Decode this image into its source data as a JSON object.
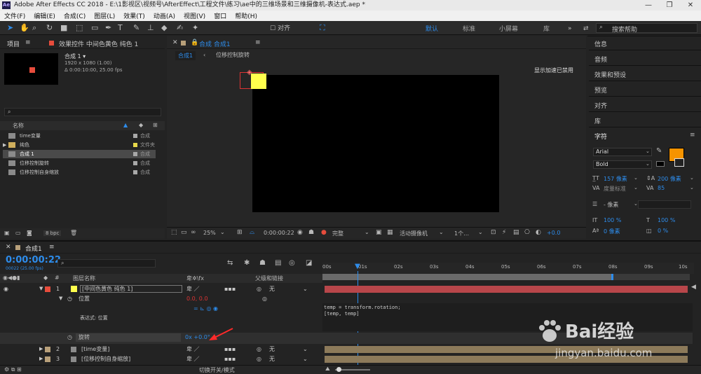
{
  "window": {
    "app_icon": "Ae",
    "title": "Adobe After Effects CC 2018 - E:\\1影视区\\视频号\\AfterEffect\\工程文件\\练习\\ae中的三维场景和三维摄像机-表达式.aep *",
    "controls": [
      "—",
      "❐",
      "✕"
    ]
  },
  "menu": [
    "文件(F)",
    "编辑(E)",
    "合成(C)",
    "图层(L)",
    "效果(T)",
    "动画(A)",
    "视图(V)",
    "窗口",
    "帮助(H)"
  ],
  "toolbar": {
    "align_label": "对齐",
    "workspaces": [
      "默认",
      "标准",
      "小屏幕",
      "库"
    ],
    "search_placeholder": "搜索帮助"
  },
  "project": {
    "tab_label": "项目",
    "effects_tab_label": "效果控件 中间色黄色 纯色 1",
    "comp_name": "合成 1 ▾",
    "comp_info": [
      "1920 x 1080 (1.00)",
      "Δ 0:00:10:00, 25.00 fps"
    ],
    "col_name": "名称",
    "items": [
      {
        "name": "time变量",
        "type": "合成",
        "color": "#a8a8a8"
      },
      {
        "name": "纯色",
        "type": "文件夹",
        "color": "#e6d84a"
      },
      {
        "name": "合成 1",
        "type": "合成",
        "color": "#a8a8a8"
      },
      {
        "name": "位移控制旋转",
        "type": "合成",
        "color": "#a8a8a8"
      },
      {
        "name": "位移控制自身缩放",
        "type": "合成",
        "color": "#a8a8a8"
      }
    ],
    "bpc": "8 bpc"
  },
  "composition": {
    "tab_label": "合成 合成1",
    "breadcrumbs": [
      "合成1",
      "位移控制旋转"
    ],
    "accel_note": "显示加速已禁用",
    "zoom": "25%",
    "timecode": "0:00:00:22",
    "quality": "完整",
    "camera": "活动摄像机",
    "views": "1个…",
    "exposure": "+0.0"
  },
  "right_panel": {
    "items": [
      "信息",
      "音频",
      "效果和预设",
      "预览",
      "对齐",
      "库"
    ],
    "character_label": "字符",
    "font": "Arial",
    "style": "Bold",
    "font_size": "157 像素",
    "leading": "200 像素",
    "kerning": "度量标准",
    "tracking": "85",
    "indent": "- 像素",
    "vscale": "100 %",
    "hscale": "100 %",
    "baseline": "0 像素",
    "tsume": "0 %",
    "fill_color": "#f59300"
  },
  "timeline": {
    "tab_label": "合成1",
    "timecode": "0:00:00:22",
    "timecode_sub": "00022 (25.00 fps)",
    "col_layer": "图层名称",
    "col_parent": "父级和链接",
    "ticks": [
      "00s",
      "01s",
      "02s",
      "03s",
      "04s",
      "05s",
      "06s",
      "07s",
      "08s",
      "09s",
      "10s"
    ],
    "layers": [
      {
        "index": "1",
        "name": "[中间色黄色 纯色 1]",
        "color": "#e74c3c",
        "parent": "无"
      },
      {
        "index": "2",
        "name": "[time变量]",
        "color": "#b8a07a",
        "parent": "无"
      },
      {
        "index": "3",
        "name": "[位移控制自身缩放]",
        "color": "#b8a07a",
        "parent": "无"
      }
    ],
    "prop_position": "位置",
    "prop_position_value": "0.0, 0.0",
    "expression_label": "表达式: 位置",
    "expression_text": [
      "temp = transform.rotation;",
      "[temp, temp]"
    ],
    "prop_rotation": "旋转",
    "prop_rotation_value": "0x +0.0°",
    "footer": "切换开关/模式"
  },
  "watermark": {
    "brand": "Bai经验",
    "url": "jingyan.baidu.com"
  }
}
